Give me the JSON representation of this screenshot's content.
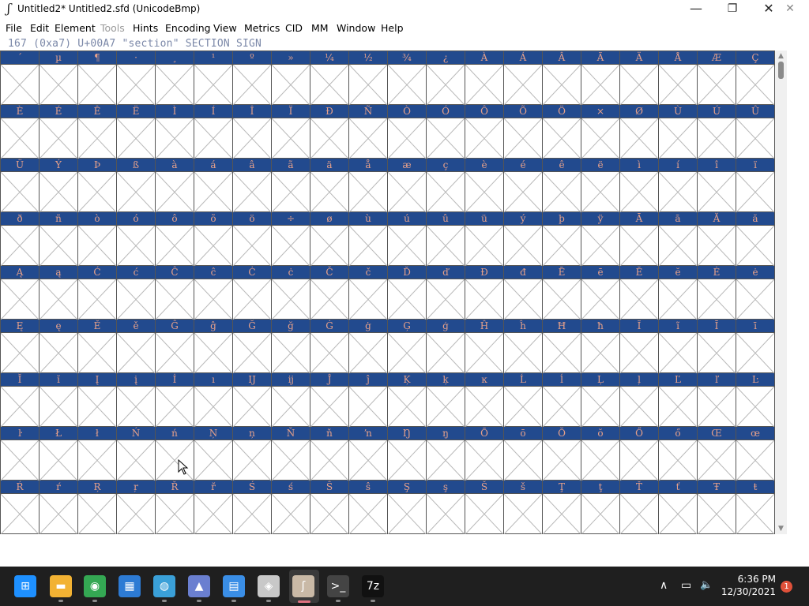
{
  "window": {
    "title": "Untitled2*  Untitled2.sfd (UnicodeBmp)",
    "app_icon_glyph": "ʃ",
    "minimize_glyph": "—",
    "maximize_glyph": "❐",
    "close_glyph": "✕",
    "extra_close_glyph": "✕"
  },
  "menubar": {
    "items": [
      {
        "label": "File"
      },
      {
        "label": "Edit"
      },
      {
        "label": "Element"
      },
      {
        "label": "Tools",
        "disabled": true
      },
      {
        "label": "Hints"
      },
      {
        "label": "Encoding"
      },
      {
        "label": "View"
      },
      {
        "label": "Metrics"
      },
      {
        "label": "CID"
      },
      {
        "label": "MM"
      },
      {
        "label": "Window"
      },
      {
        "label": "Help"
      }
    ]
  },
  "info_line": "167 (0xa7) U+00A7 \"section\" SECTION SIGN",
  "glyph_rows": [
    [
      "´",
      "µ",
      "¶",
      "·",
      "¸",
      "¹",
      "º",
      "»",
      "¼",
      "½",
      "¾",
      "¿",
      "À",
      "Á",
      "Â",
      "Ã",
      "Ä",
      "Å",
      "Æ",
      "Ç"
    ],
    [
      "È",
      "É",
      "Ê",
      "Ë",
      "Ì",
      "Í",
      "Î",
      "Ï",
      "Ð",
      "Ñ",
      "Ò",
      "Ó",
      "Ô",
      "Õ",
      "Ö",
      "×",
      "Ø",
      "Ù",
      "Ú",
      "Û"
    ],
    [
      "Ü",
      "Ý",
      "Þ",
      "ß",
      "à",
      "á",
      "â",
      "ã",
      "ä",
      "å",
      "æ",
      "ç",
      "è",
      "é",
      "ê",
      "ë",
      "ì",
      "í",
      "î",
      "ï"
    ],
    [
      "ð",
      "ñ",
      "ò",
      "ó",
      "ô",
      "õ",
      "ö",
      "÷",
      "ø",
      "ù",
      "ú",
      "û",
      "ü",
      "ý",
      "þ",
      "ÿ",
      "Ā",
      "ā",
      "Ă",
      "ă"
    ],
    [
      "Ą",
      "ą",
      "Ć",
      "ć",
      "Ĉ",
      "ĉ",
      "Ċ",
      "ċ",
      "Č",
      "č",
      "Ď",
      "ď",
      "Đ",
      "đ",
      "Ē",
      "ē",
      "Ĕ",
      "ĕ",
      "Ė",
      "ė"
    ],
    [
      "Ę",
      "ę",
      "Ě",
      "ě",
      "Ĝ",
      "ĝ",
      "Ğ",
      "ğ",
      "Ġ",
      "ġ",
      "Ģ",
      "ģ",
      "Ĥ",
      "ĥ",
      "Ħ",
      "ħ",
      "Ĩ",
      "ĩ",
      "Ī",
      "ī"
    ],
    [
      "Ĭ",
      "ĭ",
      "Į",
      "į",
      "İ",
      "ı",
      "Ĳ",
      "ĳ",
      "Ĵ",
      "ĵ",
      "Ķ",
      "ķ",
      "ĸ",
      "Ĺ",
      "ĺ",
      "Ļ",
      "ļ",
      "Ľ",
      "ľ",
      "Ŀ"
    ],
    [
      "ŀ",
      "Ł",
      "ł",
      "Ń",
      "ń",
      "Ņ",
      "ņ",
      "Ň",
      "ň",
      "ŉ",
      "Ŋ",
      "ŋ",
      "Ō",
      "ō",
      "Ŏ",
      "ŏ",
      "Ő",
      "ő",
      "Œ",
      "œ"
    ],
    [
      "Ŕ",
      "ŕ",
      "Ŗ",
      "ŗ",
      "Ř",
      "ř",
      "Ś",
      "ś",
      "Ŝ",
      "ŝ",
      "Ş",
      "ş",
      "Š",
      "š",
      "Ţ",
      "ţ",
      "Ť",
      "ť",
      "Ŧ",
      "ŧ"
    ]
  ],
  "scrollbar": {
    "up_glyph": "▲",
    "down_glyph": "▼"
  },
  "taskbar": {
    "apps": [
      {
        "name": "start-icon",
        "glyph": "⊞",
        "color": "#1e90ff"
      },
      {
        "name": "file-explorer-icon",
        "glyph": "▬",
        "color": "#f2b233"
      },
      {
        "name": "chrome-icon",
        "glyph": "◉",
        "color": "#34a853"
      },
      {
        "name": "store-icon",
        "glyph": "▦",
        "color": "#2d7bd4"
      },
      {
        "name": "maps-icon",
        "glyph": "◍",
        "color": "#3aa0d8"
      },
      {
        "name": "inkscape-icon",
        "glyph": "▲",
        "color": "#6a7fd0"
      },
      {
        "name": "notepad-icon",
        "glyph": "▤",
        "color": "#3a8ee6"
      },
      {
        "name": "box-icon",
        "glyph": "◈",
        "color": "#c8c8c8"
      },
      {
        "name": "fontforge-icon",
        "glyph": "ʃ",
        "color": "#c9b9a6"
      },
      {
        "name": "terminal-icon",
        "glyph": ">_",
        "color": "#444444"
      },
      {
        "name": "7zip-icon",
        "glyph": "7z",
        "color": "#111111"
      }
    ],
    "tray": {
      "chevron_glyph": "∧",
      "network_glyph": "▭",
      "volume_glyph": "🔈"
    },
    "time": "6:36 PM",
    "date": "12/30/2021",
    "notification_count": "1"
  }
}
